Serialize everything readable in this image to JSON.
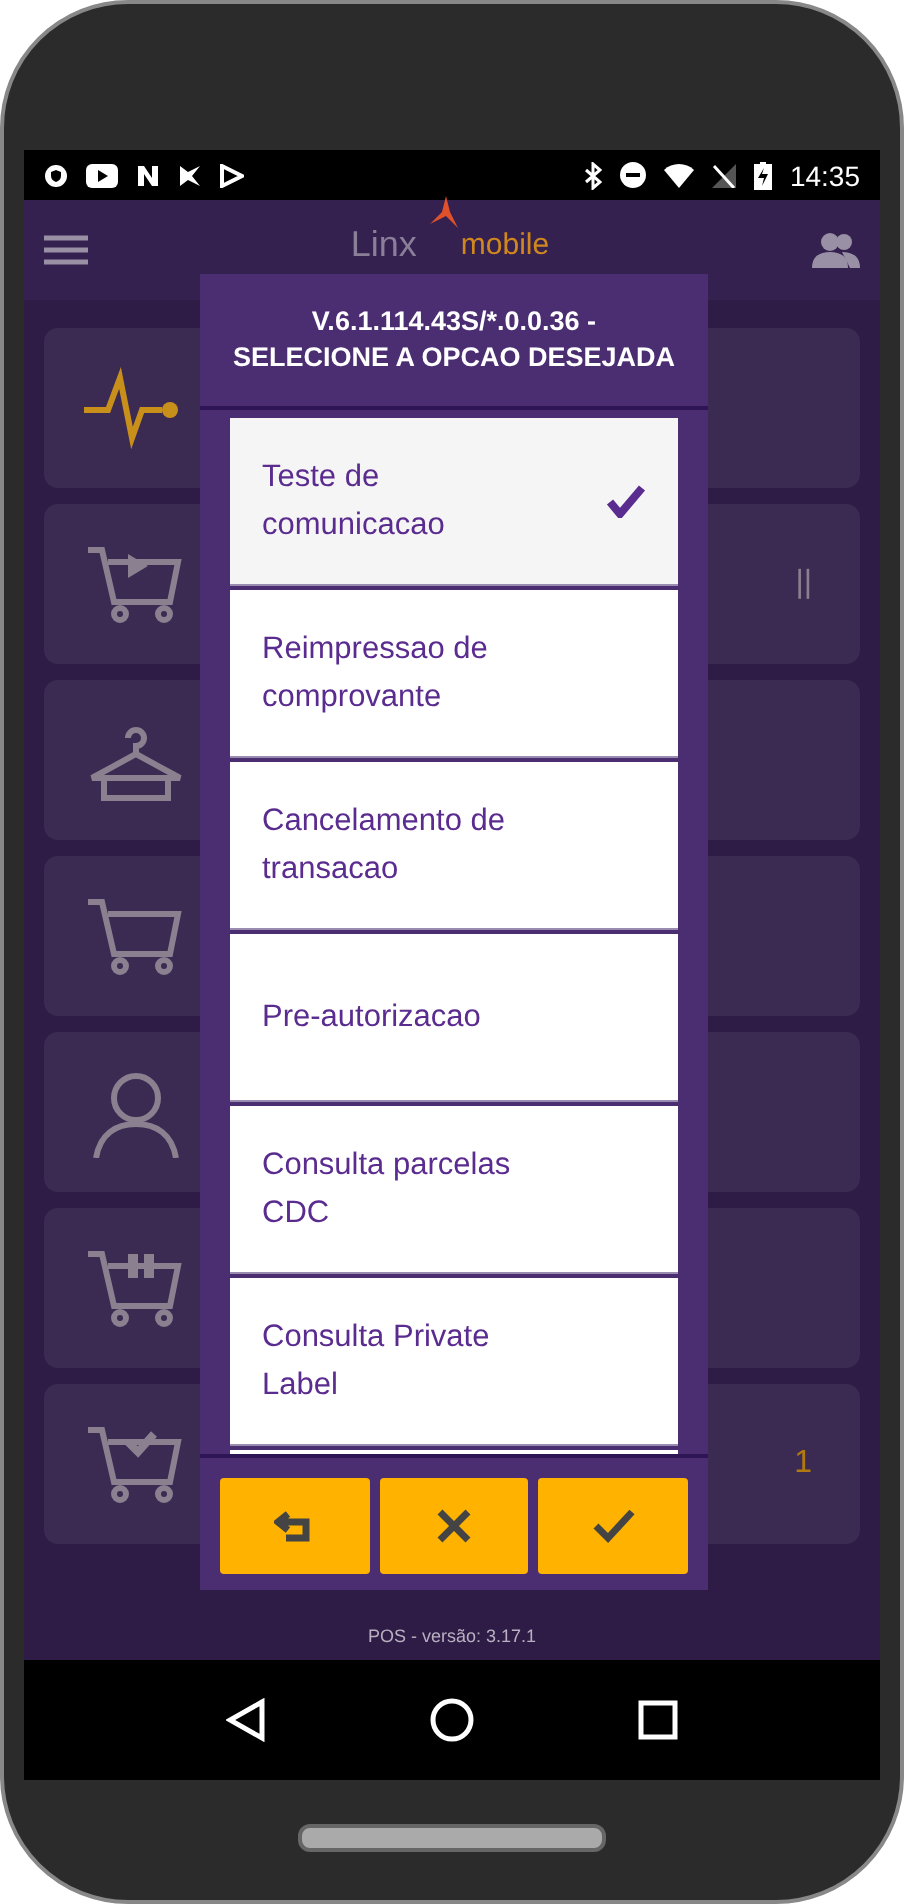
{
  "status_bar": {
    "time": "14:35"
  },
  "header": {
    "logo_brand": "Linx",
    "logo_product": "mobile"
  },
  "cards": [
    {
      "kind": "pulse"
    },
    {
      "kind": "resume",
      "value": "||"
    },
    {
      "kind": "hanger"
    },
    {
      "kind": "cart"
    },
    {
      "kind": "person"
    },
    {
      "kind": "paused"
    },
    {
      "kind": "done",
      "value": "1"
    }
  ],
  "dialog": {
    "title": [
      "V.6.1.114.43S/*.0.0.36 -",
      "SELECIONE A OPCAO DESEJADA"
    ],
    "options": [
      {
        "label": "Teste de comunicacao",
        "selected": true
      },
      {
        "label": "Reimpressao de comprovante",
        "selected": false
      },
      {
        "label": "Cancelamento de transacao",
        "selected": false
      },
      {
        "label": "Pre-autorizacao",
        "selected": false
      },
      {
        "label": "Consulta parcelas CDC",
        "selected": false
      },
      {
        "label": "Consulta Private Label",
        "selected": false
      }
    ],
    "buttons": [
      {
        "kind": "back"
      },
      {
        "kind": "cancel"
      },
      {
        "kind": "confirm"
      }
    ]
  },
  "footer": {
    "version": "POS - versão: 3.17.1"
  }
}
